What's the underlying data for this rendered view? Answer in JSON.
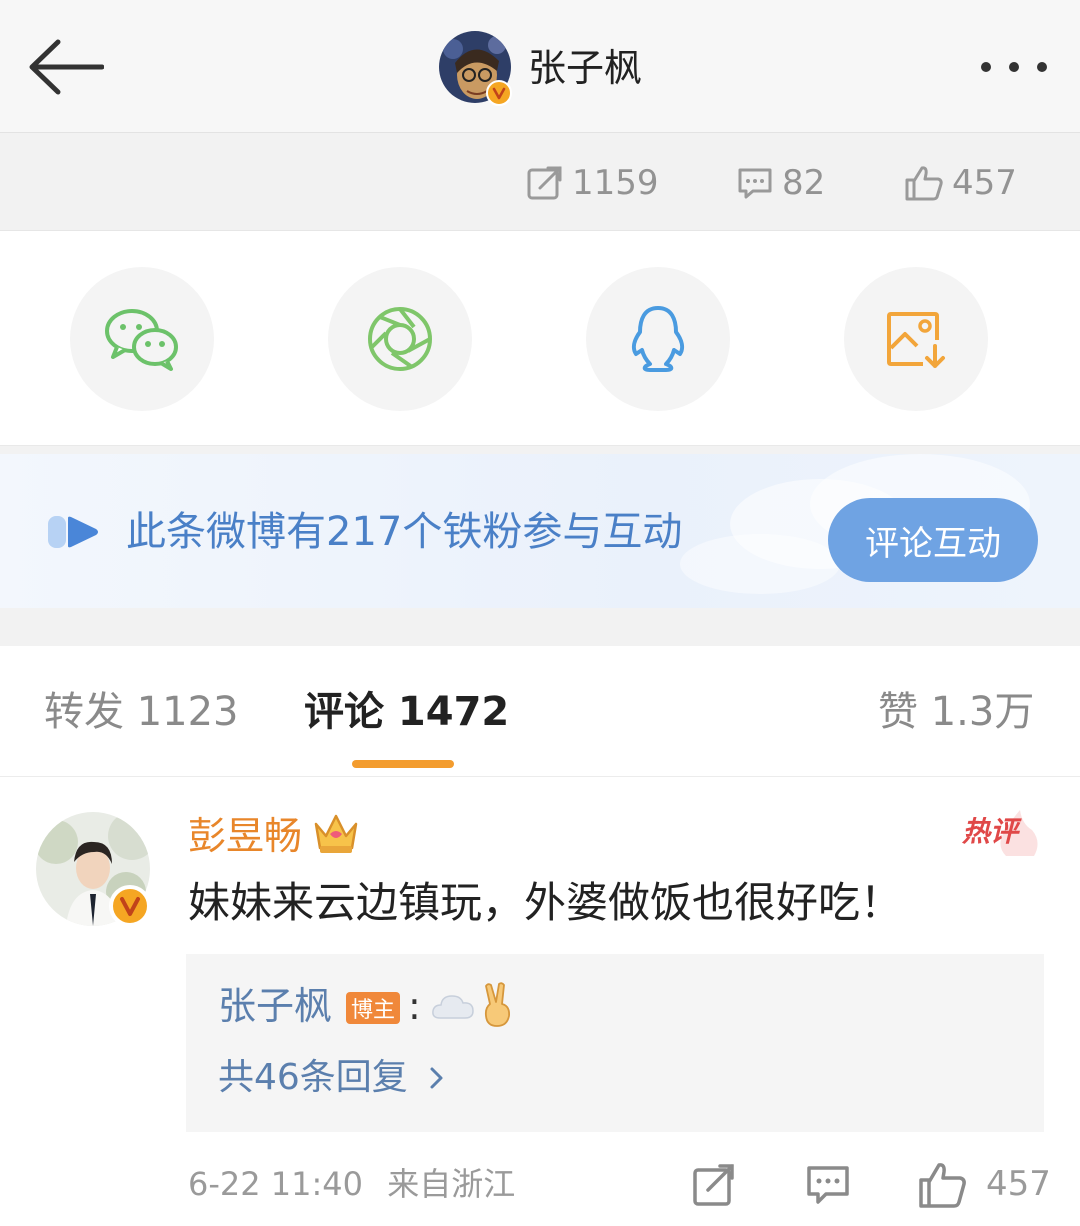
{
  "header": {
    "back_icon": "back-arrow-icon",
    "title": "张子枫",
    "more_icon": "more-dots-icon"
  },
  "stats": {
    "reposts": "1159",
    "comments": "82",
    "likes": "457"
  },
  "share": {
    "targets": [
      "wechat-icon",
      "moments-icon",
      "qq-icon",
      "save-image-icon"
    ]
  },
  "banner": {
    "text": "此条微博有217个铁粉参与互动",
    "button": "评论互动"
  },
  "tabs": {
    "repost": "转发 1123",
    "comment": "评论 1472",
    "like": "赞 1.3万",
    "active": "comment"
  },
  "comment": {
    "author": "彭昱畅",
    "hot_label": "热评",
    "text": "妹妹来云边镇玩，外婆做饭也很好吃！",
    "reply_author": "张子枫",
    "reply_badge": "博主",
    "reply_colon": ":",
    "reply_count": "共46条回复",
    "time": "6-22 11:40",
    "source": "来自浙江",
    "like_count": "457"
  },
  "colors": {
    "accent_orange": "#f39c2e",
    "link_blue": "#5b7fad",
    "banner_blue": "#4a80c7",
    "button_blue": "#6fa3e3",
    "wechat_green": "#6cc26a",
    "qq_blue": "#4a9be0",
    "save_orange": "#f2a53a"
  }
}
